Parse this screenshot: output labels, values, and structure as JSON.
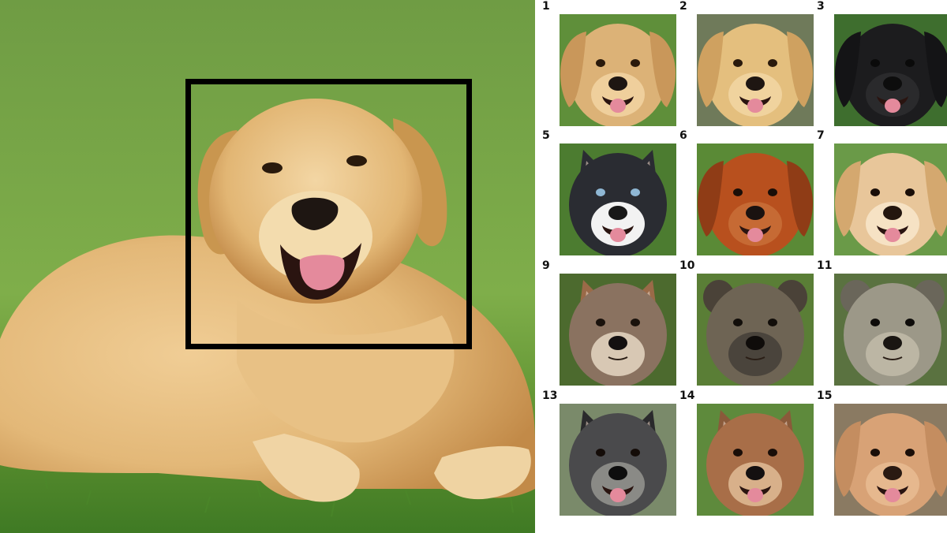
{
  "source_photo": {
    "subject": "golden-retriever",
    "background": "grass",
    "colors": {
      "grass_light": "#7fae4a",
      "grass_dark": "#3f7a24",
      "fur": "#e3b878",
      "fur_dark": "#b8853f",
      "highlight_box": "#000000"
    }
  },
  "grid": {
    "cells": [
      {
        "number": "1",
        "animal": "golden-retriever",
        "bg": "#5f8f3a",
        "fur": "#dcb277",
        "ear": "#c9975a",
        "eye": "#2a1a0c",
        "nose": "#1e1612",
        "muzzle": "#efcf9c",
        "ears": "floppy",
        "tongue": true
      },
      {
        "number": "2",
        "animal": "labrador",
        "bg": "#6f7a5a",
        "fur": "#e4bf7e",
        "ear": "#cfa160",
        "eye": "#2a1a0c",
        "nose": "#1e1612",
        "muzzle": "#f0d39e",
        "ears": "floppy",
        "tongue": true
      },
      {
        "number": "3",
        "animal": "black-curly-dog",
        "bg": "#3e6e2e",
        "fur": "#1c1c1e",
        "ear": "#141416",
        "eye": "#0a0a0a",
        "nose": "#0d0d0d",
        "muzzle": "#2a2a2c",
        "ears": "floppy",
        "tongue": true
      },
      {
        "number": "5",
        "animal": "husky",
        "bg": "#4c7c30",
        "fur": "#2a2c32",
        "ear": "#2a2c32",
        "eye": "#8fb7d4",
        "nose": "#181818",
        "muzzle": "#f2f2f2",
        "ears": "pointed",
        "tongue": true
      },
      {
        "number": "6",
        "animal": "red-wire-haired-dog",
        "bg": "#5a8a36",
        "fur": "#b8501e",
        "ear": "#8f3c16",
        "eye": "#1a0e08",
        "nose": "#1a1210",
        "muzzle": "#c66a34",
        "ears": "floppy",
        "tongue": true
      },
      {
        "number": "7",
        "animal": "cocker-spaniel",
        "bg": "#6a9a48",
        "fur": "#e8c69a",
        "ear": "#d4a86f",
        "eye": "#1a0e08",
        "nose": "#24160e",
        "muzzle": "#f6e2c4",
        "ears": "floppy",
        "tongue": true
      },
      {
        "number": "9",
        "animal": "fox",
        "bg": "#4c6a2e",
        "fur": "#8a7260",
        "ear": "#9a6a48",
        "eye": "#1a120c",
        "nose": "#141010",
        "muzzle": "#d8c8b4",
        "ears": "pointed",
        "tongue": false
      },
      {
        "number": "10",
        "animal": "hyena",
        "bg": "#5a7e36",
        "fur": "#6e6454",
        "ear": "#4a4238",
        "eye": "#120e0a",
        "nose": "#0f0c0a",
        "muzzle": "#4a443c",
        "ears": "round",
        "tongue": false
      },
      {
        "number": "11",
        "animal": "meerkat",
        "bg": "#5a7240",
        "fur": "#9c9888",
        "ear": "#6a665a",
        "eye": "#0e0c0a",
        "nose": "#1a1612",
        "muzzle": "#bcb6a4",
        "ears": "round",
        "tongue": false
      },
      {
        "number": "13",
        "animal": "keeshond",
        "bg": "#7a8a6a",
        "fur": "#4a4a4c",
        "ear": "#2a2a2c",
        "eye": "#140c08",
        "nose": "#0e0e0e",
        "muzzle": "#8a8a86",
        "ears": "pointed",
        "tongue": true
      },
      {
        "number": "14",
        "animal": "wild-dog",
        "bg": "#5e8a3c",
        "fur": "#a86e48",
        "ear": "#8a5a3a",
        "eye": "#1a0e08",
        "nose": "#141010",
        "muzzle": "#d8b08a",
        "ears": "pointed",
        "tongue": true
      },
      {
        "number": "15",
        "animal": "poodle",
        "bg": "#8a7a62",
        "fur": "#d8a276",
        "ear": "#c48d60",
        "eye": "#1a0e08",
        "nose": "#2a1a12",
        "muzzle": "#e6b88e",
        "ears": "floppy",
        "tongue": true
      }
    ]
  }
}
